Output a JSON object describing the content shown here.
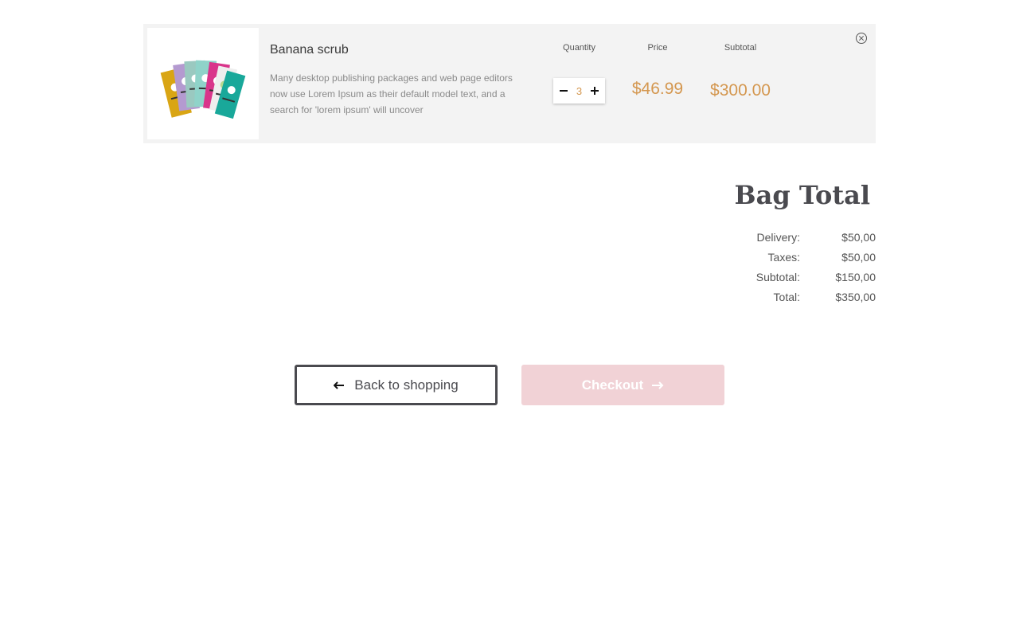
{
  "cart": {
    "item": {
      "title": "Banana scrub",
      "description": "Many desktop publishing packages and web page editors now use Lorem Ipsum as their default model text, and a search for 'lorem ipsum' will uncover",
      "quantity": "3",
      "price": "$46.99",
      "subtotal": "$300.00"
    },
    "columns": {
      "quantity": "Quantity",
      "price": "Price",
      "subtotal": "Subtotal"
    },
    "icons": {
      "decrement": "minus-icon",
      "increment": "plus-icon",
      "remove": "close-circle-icon"
    }
  },
  "bag": {
    "title": "Bag Total",
    "rows": [
      {
        "label": "Delivery:",
        "value": "$50,00"
      },
      {
        "label": "Taxes:",
        "value": "$50,00"
      },
      {
        "label": "Subtotal:",
        "value": "$150,00"
      },
      {
        "label": "Total:",
        "value": "$350,00"
      }
    ]
  },
  "actions": {
    "back_label": "Back to shopping",
    "checkout_label": "Checkout"
  },
  "colors": {
    "accent_price": "#d4974f",
    "row_background": "#f3f3f3",
    "checkout_background": "#f1d2d6",
    "dark_text": "#4a4a4f"
  }
}
